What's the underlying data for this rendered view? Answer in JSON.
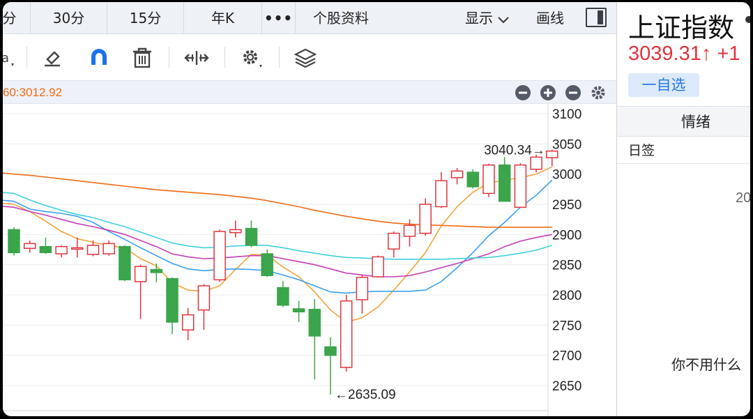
{
  "tabs": [
    {
      "label": "分"
    },
    {
      "label": "30分"
    },
    {
      "label": "15分"
    },
    {
      "label": "年K"
    },
    {
      "label": "•••"
    },
    {
      "label": "个股资料"
    },
    {
      "label": "显示"
    },
    {
      "label": "画线"
    }
  ],
  "toolbar": {
    "icons": [
      "text-tool-icon",
      "eraser-icon",
      "magnet-icon",
      "trash-icon",
      "scale-icon",
      "settings-icon",
      "layers-icon"
    ]
  },
  "infobar": {
    "ma_text": "60:3012.92",
    "buttons": [
      "zoom-out-icon",
      "zoom-in-icon",
      "minus-icon",
      "gear-icon"
    ]
  },
  "chart_data": {
    "type": "candlestick",
    "y_ticks": [
      "3100",
      "3050",
      "3000",
      "2950",
      "2900",
      "2850",
      "2800",
      "2750",
      "2700",
      "2650"
    ],
    "ylim": [
      2630,
      3110
    ],
    "annotations": [
      {
        "text": "3040.34→",
        "value": 3040.34
      },
      {
        "text": "←2635.09",
        "value": 2635.09
      }
    ],
    "candles": [
      {
        "o": 2908,
        "c": 2870,
        "h": 2912,
        "l": 2865,
        "up": false
      },
      {
        "o": 2877,
        "c": 2885,
        "h": 2890,
        "l": 2870,
        "up": true
      },
      {
        "o": 2880,
        "c": 2870,
        "h": 2895,
        "l": 2868,
        "up": false
      },
      {
        "o": 2868,
        "c": 2880,
        "h": 2882,
        "l": 2862,
        "up": true
      },
      {
        "o": 2876,
        "c": 2878,
        "h": 2895,
        "l": 2862,
        "up": true
      },
      {
        "o": 2867,
        "c": 2882,
        "h": 2890,
        "l": 2864,
        "up": true
      },
      {
        "o": 2868,
        "c": 2885,
        "h": 2890,
        "l": 2865,
        "up": true
      },
      {
        "o": 2880,
        "c": 2825,
        "h": 2882,
        "l": 2823,
        "up": false
      },
      {
        "o": 2822,
        "c": 2847,
        "h": 2850,
        "l": 2760,
        "up": true
      },
      {
        "o": 2842,
        "c": 2837,
        "h": 2852,
        "l": 2821,
        "up": false
      },
      {
        "o": 2827,
        "c": 2755,
        "h": 2829,
        "l": 2735,
        "up": false
      },
      {
        "o": 2742,
        "c": 2767,
        "h": 2778,
        "l": 2725,
        "up": true
      },
      {
        "o": 2775,
        "c": 2815,
        "h": 2818,
        "l": 2742,
        "up": true
      },
      {
        "o": 2825,
        "c": 2905,
        "h": 2908,
        "l": 2822,
        "up": true
      },
      {
        "o": 2903,
        "c": 2908,
        "h": 2923,
        "l": 2895,
        "up": true
      },
      {
        "o": 2910,
        "c": 2882,
        "h": 2923,
        "l": 2879,
        "up": false
      },
      {
        "o": 2868,
        "c": 2832,
        "h": 2875,
        "l": 2830,
        "up": false
      },
      {
        "o": 2812,
        "c": 2783,
        "h": 2823,
        "l": 2780,
        "up": false
      },
      {
        "o": 2777,
        "c": 2772,
        "h": 2790,
        "l": 2755,
        "up": false
      },
      {
        "o": 2776,
        "c": 2732,
        "h": 2793,
        "l": 2660,
        "up": false
      },
      {
        "o": 2714,
        "c": 2700,
        "h": 2730,
        "l": 2635.09,
        "up": false
      },
      {
        "o": 2680,
        "c": 2790,
        "h": 2800,
        "l": 2673,
        "up": true
      },
      {
        "o": 2792,
        "c": 2829,
        "h": 2833,
        "l": 2769,
        "up": true
      },
      {
        "o": 2830,
        "c": 2863,
        "h": 2865,
        "l": 2829,
        "up": true
      },
      {
        "o": 2876,
        "c": 2902,
        "h": 2905,
        "l": 2862,
        "up": true
      },
      {
        "o": 2897,
        "c": 2915,
        "h": 2925,
        "l": 2880,
        "up": true
      },
      {
        "o": 2902,
        "c": 2950,
        "h": 2960,
        "l": 2898,
        "up": true
      },
      {
        "o": 2946,
        "c": 2989,
        "h": 3003,
        "l": 2944,
        "up": true
      },
      {
        "o": 2994,
        "c": 3005,
        "h": 3010,
        "l": 2983,
        "up": true
      },
      {
        "o": 3003,
        "c": 2979,
        "h": 3008,
        "l": 2976,
        "up": false
      },
      {
        "o": 2968,
        "c": 3015,
        "h": 3017,
        "l": 2962,
        "up": true
      },
      {
        "o": 3015,
        "c": 2955,
        "h": 3028,
        "l": 2955,
        "up": false
      },
      {
        "o": 2945,
        "c": 3015,
        "h": 3018,
        "l": 2944,
        "up": true
      },
      {
        "o": 3008,
        "c": 3028,
        "h": 3032,
        "l": 3003,
        "up": true
      },
      {
        "o": 3027,
        "c": 3038,
        "h": 3040.34,
        "l": 3013,
        "up": true
      }
    ],
    "ma_lines": [
      {
        "color": "#f5a33b",
        "values": [
          2950,
          2938,
          2922,
          2905,
          2893,
          2887,
          2882,
          2878,
          2860,
          2848,
          2820,
          2808,
          2806,
          2815,
          2842,
          2867,
          2866,
          2846,
          2830,
          2805,
          2775,
          2755,
          2762,
          2780,
          2808,
          2838,
          2870,
          2914,
          2946,
          2970,
          2985,
          2990,
          2994,
          3000,
          3012
        ]
      },
      {
        "color": "#3aa0f0",
        "values": [
          2955,
          2942,
          2938,
          2935,
          2930,
          2920,
          2905,
          2892,
          2878,
          2865,
          2852,
          2843,
          2840,
          2842,
          2843,
          2842,
          2840,
          2833,
          2825,
          2815,
          2805,
          2803,
          2805,
          2806,
          2806,
          2806,
          2808,
          2822,
          2845,
          2870,
          2898,
          2920,
          2945,
          2965,
          2990
        ]
      },
      {
        "color": "#c63db8",
        "values": [
          2945,
          2938,
          2932,
          2925,
          2918,
          2913,
          2907,
          2900,
          2890,
          2880,
          2868,
          2863,
          2860,
          2861,
          2863,
          2865,
          2865,
          2860,
          2855,
          2850,
          2843,
          2836,
          2833,
          2830,
          2830,
          2832,
          2838,
          2845,
          2852,
          2860,
          2868,
          2880,
          2889,
          2895,
          2900
        ]
      },
      {
        "color": "#3fd0dc",
        "values": [
          2968,
          2957,
          2948,
          2940,
          2933,
          2928,
          2920,
          2913,
          2904,
          2895,
          2886,
          2881,
          2878,
          2879,
          2881,
          2882,
          2882,
          2878,
          2873,
          2869,
          2865,
          2862,
          2861,
          2860,
          2859,
          2859,
          2859,
          2859,
          2860,
          2861,
          2862,
          2865,
          2869,
          2874,
          2882
        ]
      },
      {
        "color": "#f06a14",
        "values": [
          3000,
          2998,
          2995,
          2992,
          2989,
          2986,
          2983,
          2980,
          2977,
          2974,
          2972,
          2970,
          2968,
          2966,
          2963,
          2960,
          2956,
          2951,
          2946,
          2940,
          2935,
          2930,
          2926,
          2922,
          2919,
          2917,
          2916,
          2915,
          2914,
          2913,
          2912,
          2912,
          2912,
          2912,
          2912
        ]
      }
    ]
  },
  "right_panel": {
    "index_name": "上证指数",
    "price_text": "3039.31↑ +1",
    "watch_label": "一自选",
    "mood_tab": "情绪",
    "daily_sign": "日签",
    "sign_date": "20",
    "sign_quote": "你不用什么"
  },
  "colors": {
    "up": "#e0343f",
    "down": "#3aa54a",
    "ma60": "#f06a14",
    "accent": "#2a78e4"
  }
}
